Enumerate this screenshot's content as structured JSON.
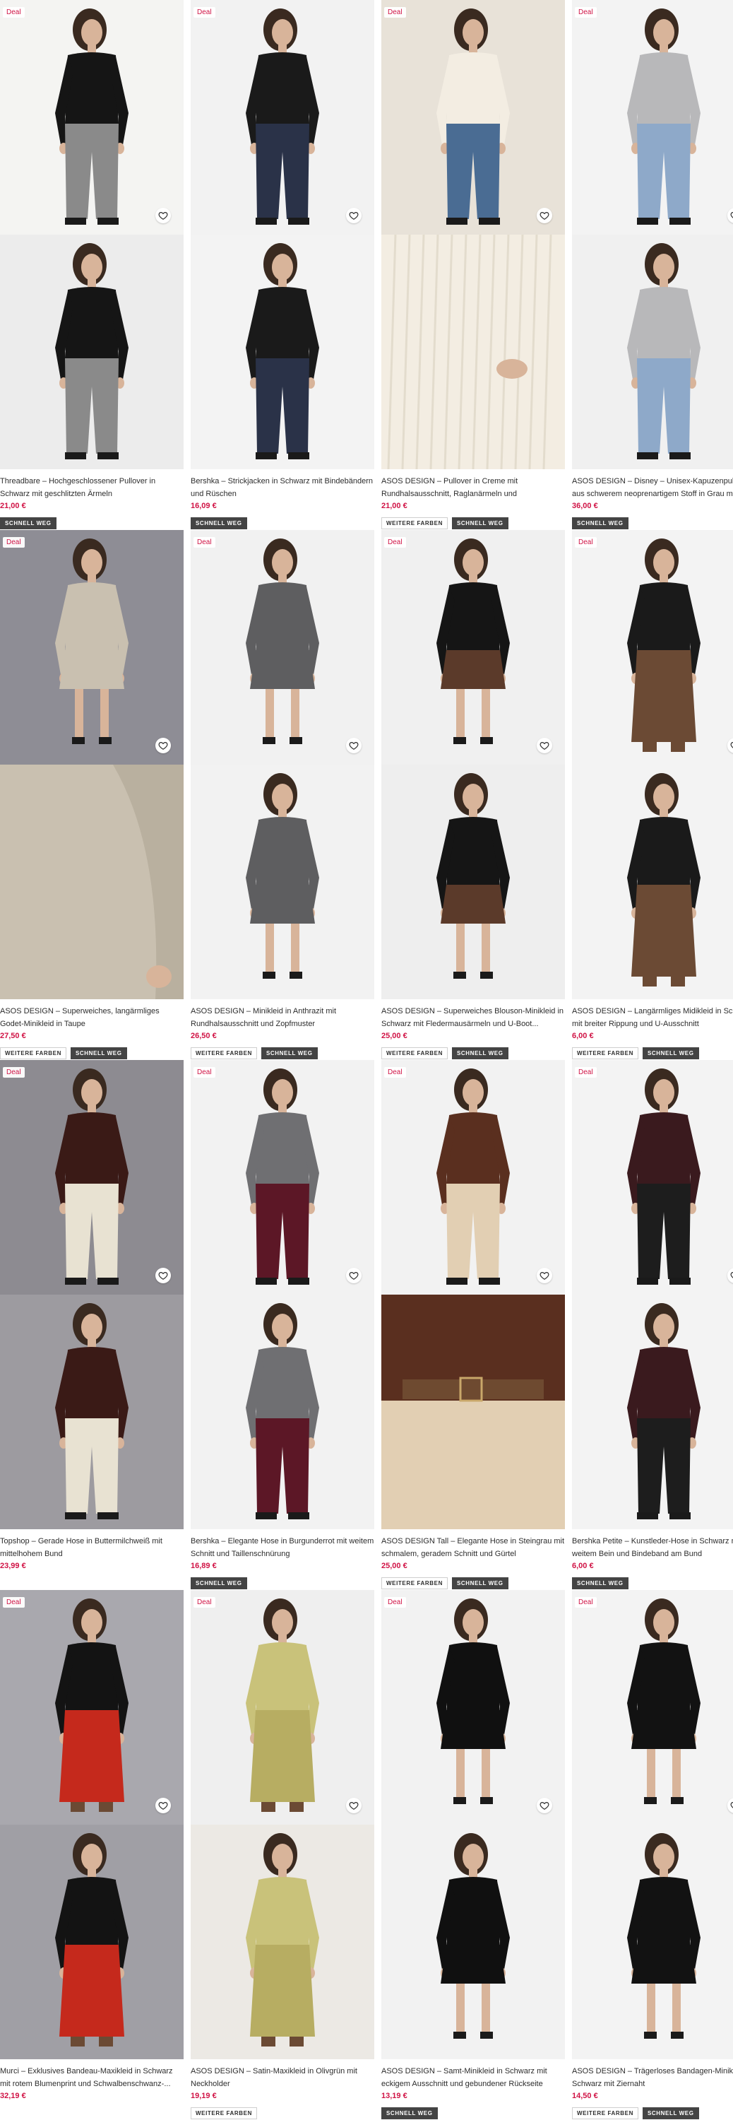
{
  "deal_label": "Deal",
  "accent_color": "#d01345",
  "products": [
    {
      "deal": true,
      "title": "Threadbare – Hochgeschlossener Pullover in Schwarz mit geschlitzten Ärmeln",
      "price": "21,00 €",
      "badges": [
        "SCHNELL WEG"
      ],
      "img_bg": [
        "#f4f4f2",
        "#ececec"
      ],
      "figure": "black-top"
    },
    {
      "deal": true,
      "title": "Bershka – Strickjacken in Schwarz mit Bindebändern und Rüschen",
      "price": "16,09 €",
      "badges": [
        "SCHNELL WEG"
      ],
      "img_bg": [
        "#f2f2f2",
        "#f3f3f3"
      ],
      "figure": "black-cardigan"
    },
    {
      "deal": true,
      "title": "ASOS DESIGN – Pullover in Creme mit Rundhalsausschnitt, Raglanärmeln und Patentstrick...",
      "price": "21,00 €",
      "badges": [
        "WEITERE FARBEN",
        "SCHNELL WEG"
      ],
      "img_bg": [
        "#e8e2d8",
        "#dcd4c8"
      ],
      "figure": "cream-sweater"
    },
    {
      "deal": true,
      "title": "ASOS DESIGN – Disney – Unisex-Kapuzenpullover aus schwerem neoprenartigem Stoff in Grau mit...",
      "price": "36,00 €",
      "badges": [
        "SCHNELL WEG"
      ],
      "img_bg": [
        "#f3f3f3",
        "#f0f0f0"
      ],
      "figure": "grey-hoodies"
    },
    {
      "deal": true,
      "title": "ASOS DESIGN – Superweiches, langärmliges Godet-Minikleid in Taupe",
      "price": "27,50 €",
      "badges": [
        "WEITERE FARBEN",
        "SCHNELL WEG"
      ],
      "img_bg": [
        "#8e8d95",
        "#bcb8ae"
      ],
      "figure": "taupe-dress"
    },
    {
      "deal": true,
      "title": "ASOS DESIGN – Minikleid in Anthrazit mit Rundhalsausschnitt und Zopfmuster",
      "price": "26,50 €",
      "badges": [
        "WEITERE FARBEN",
        "SCHNELL WEG"
      ],
      "img_bg": [
        "#f1f1f1",
        "#f2f2f2"
      ],
      "figure": "grey-knit-dress"
    },
    {
      "deal": true,
      "title": "ASOS DESIGN – Superweiches Blouson-Minikleid in Schwarz mit Fledermausärmeln und U-Boot...",
      "price": "25,00 €",
      "badges": [
        "WEITERE FARBEN",
        "SCHNELL WEG"
      ],
      "img_bg": [
        "#f0f0f0",
        "#eeeeee"
      ],
      "figure": "black-blouson"
    },
    {
      "deal": true,
      "title": "ASOS DESIGN – Langärmliges Midikleid in Schwarz mit breiter Rippung und U-Ausschnitt",
      "price": "6,00 €",
      "badges": [
        "WEITERE FARBEN",
        "SCHNELL WEG"
      ],
      "img_bg": [
        "#f3f3f3",
        "#f3f3f3"
      ],
      "figure": "black-midi"
    },
    {
      "deal": true,
      "title": "Topshop – Gerade Hose in Buttermilchweiß mit mittelhohem Bund",
      "price": "23,99 €",
      "badges": [],
      "img_bg": [
        "#8d8b91",
        "#9d9ba0"
      ],
      "figure": "cream-trousers"
    },
    {
      "deal": true,
      "title": "Bershka – Elegante Hose in Burgunderrot mit weitem Schnitt und Taillenschnürung",
      "price": "16,89 €",
      "badges": [
        "SCHNELL WEG"
      ],
      "img_bg": [
        "#f2f2f2",
        "#f2f2f2"
      ],
      "figure": "burgundy-trousers"
    },
    {
      "deal": true,
      "title": "ASOS DESIGN Tall – Elegante Hose in Steingrau mit schmalem, geradem Schnitt und Gürtel",
      "price": "25,00 €",
      "badges": [
        "WEITERE FARBEN",
        "SCHNELL WEG"
      ],
      "img_bg": [
        "#f2f2f2",
        "#ddd0bd"
      ],
      "figure": "stone-trousers"
    },
    {
      "deal": true,
      "title": "Bershka Petite – Kunstleder-Hose in Schwarz mit weitem Bein und Bindeband am Bund",
      "price": "6,00 €",
      "badges": [
        "SCHNELL WEG"
      ],
      "img_bg": [
        "#f3f3f3",
        "#f3f3f3"
      ],
      "figure": "leather-trousers"
    },
    {
      "deal": true,
      "title": "Murci – Exklusives Bandeau-Maxikleid in Schwarz mit rotem Blumenprint und Schwalbenschwanz-...",
      "price": "32,19 €",
      "badges": [],
      "img_bg": [
        "#a9a8ae",
        "#a09fa5"
      ],
      "figure": "floral-maxi"
    },
    {
      "deal": true,
      "title": "ASOS DESIGN – Satin-Maxikleid in Olivgrün mit Neckholder",
      "price": "19,19 €",
      "badges": [
        "WEITERE FARBEN"
      ],
      "img_bg": [
        "#efefef",
        "#ece9e4"
      ],
      "figure": "olive-satin"
    },
    {
      "deal": true,
      "title": "ASOS DESIGN – Samt-Minikleid in Schwarz mit eckigem Ausschnitt und gebundener Rückseite",
      "price": "13,19 €",
      "badges": [
        "SCHNELL WEG"
      ],
      "img_bg": [
        "#f2f2f2",
        "#f2f2f2"
      ],
      "figure": "velvet-mini"
    },
    {
      "deal": true,
      "title": "ASOS DESIGN – Trägerloses Bandagen-Minikleid in Schwarz mit Ziernaht",
      "price": "14,50 €",
      "badges": [
        "WEITERE FARBEN",
        "SCHNELL WEG"
      ],
      "img_bg": [
        "#f3f3f3",
        "#f3f3f3"
      ],
      "figure": "bandage-mini"
    }
  ]
}
